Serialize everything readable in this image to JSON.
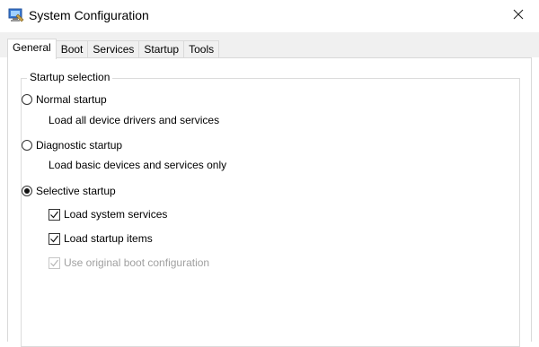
{
  "window": {
    "title": "System Configuration",
    "close_glyph": "✕"
  },
  "tabs": [
    {
      "label": "General",
      "active": true
    },
    {
      "label": "Boot",
      "active": false
    },
    {
      "label": "Services",
      "active": false
    },
    {
      "label": "Startup",
      "active": false
    },
    {
      "label": "Tools",
      "active": false
    }
  ],
  "startup_selection": {
    "legend": "Startup selection",
    "normal": {
      "label": "Normal startup",
      "description": "Load all device drivers and services",
      "selected": false
    },
    "diagnostic": {
      "label": "Diagnostic startup",
      "description": "Load basic devices and services only",
      "selected": false
    },
    "selective": {
      "label": "Selective startup",
      "selected": true,
      "options": [
        {
          "label": "Load system services",
          "checked": true,
          "enabled": true
        },
        {
          "label": "Load startup items",
          "checked": true,
          "enabled": true
        },
        {
          "label": "Use original boot configuration",
          "checked": true,
          "enabled": false
        }
      ]
    }
  },
  "icons": {
    "app": "system-configuration-icon",
    "close": "close-icon"
  }
}
